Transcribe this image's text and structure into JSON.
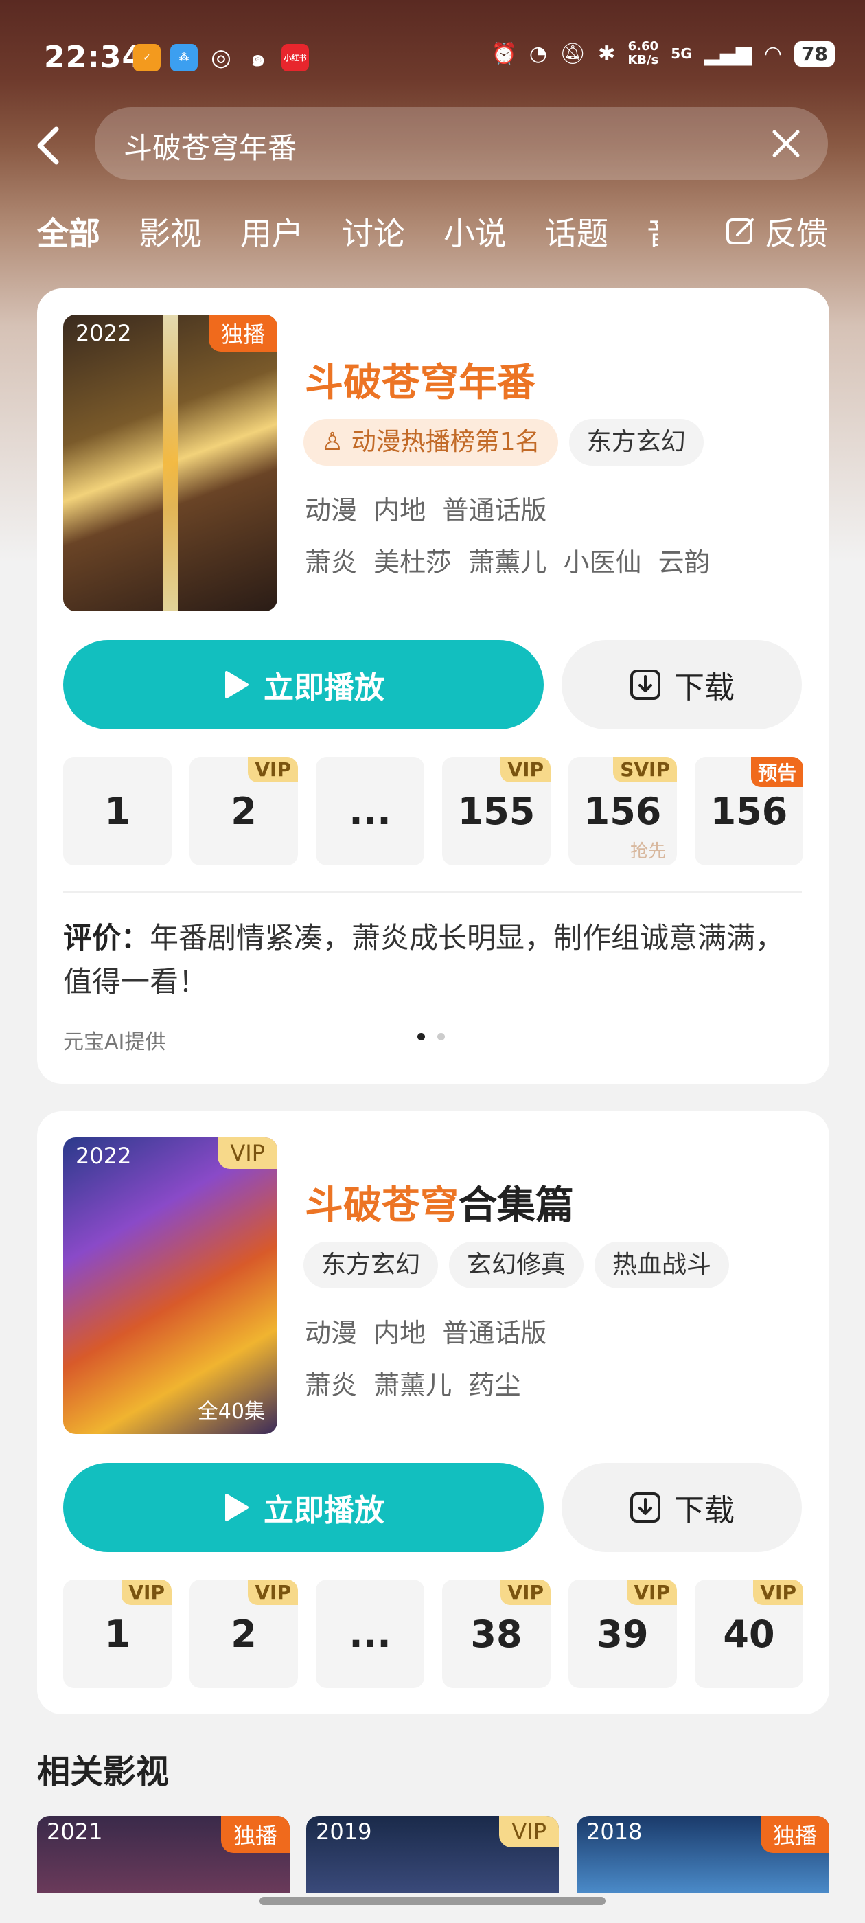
{
  "status_bar": {
    "time": "22:34",
    "app_icons": [
      "taobao-icon",
      "alipay-icon",
      "wechat-icon",
      "weibo-icon",
      "xiaohongshu-icon"
    ],
    "xiaohongshu_text": "小红书",
    "net_speed": "6.60",
    "net_unit": "KB/s",
    "signal": "5G",
    "battery": "78"
  },
  "search": {
    "query": "斗破苍穹年番"
  },
  "tabs": [
    "全部",
    "影视",
    "用户",
    "讨论",
    "小说",
    "话题",
    "音"
  ],
  "feedback_label": "反馈",
  "result1": {
    "year": "2022",
    "badge": "独播",
    "title": "斗破苍穹年番",
    "rank_chip": "动漫热播榜第1名",
    "genre_chip": "东方玄幻",
    "meta": "动漫  内地  普通话版",
    "cast": "萧炎  美杜莎  萧薰儿  小医仙  云韵",
    "play_label": "立即播放",
    "download_label": "下载",
    "episodes": [
      {
        "num": "1",
        "badge": "",
        "sub": ""
      },
      {
        "num": "2",
        "badge": "VIP",
        "sub": ""
      },
      {
        "num": "...",
        "badge": "",
        "sub": ""
      },
      {
        "num": "155",
        "badge": "VIP",
        "sub": ""
      },
      {
        "num": "156",
        "badge": "SVIP",
        "sub": "抢先"
      },
      {
        "num": "156",
        "badge": "预告",
        "sub": ""
      }
    ],
    "review_label": "评价：",
    "review_text": "年番剧情紧凑，萧炎成长明显，制作组诚意满满，值得一看！",
    "credit": "元宝AI提供",
    "page_dots": 2,
    "page_active": 1
  },
  "result2": {
    "year": "2022",
    "badge": "VIP",
    "episode_count": "全40集",
    "title_highlight": "斗破苍穹",
    "title_rest": "合集篇",
    "chips": [
      "东方玄幻",
      "玄幻修真",
      "热血战斗"
    ],
    "meta": "动漫  内地  普通话版",
    "cast": "萧炎  萧薰儿  药尘",
    "play_label": "立即播放",
    "download_label": "下载",
    "episodes": [
      {
        "num": "1",
        "badge": "VIP"
      },
      {
        "num": "2",
        "badge": "VIP"
      },
      {
        "num": "...",
        "badge": ""
      },
      {
        "num": "38",
        "badge": "VIP"
      },
      {
        "num": "39",
        "badge": "VIP"
      },
      {
        "num": "40",
        "badge": "VIP"
      }
    ]
  },
  "related": {
    "title": "相关影视",
    "items": [
      {
        "year": "2021",
        "badge": "独播"
      },
      {
        "year": "2019",
        "badge": "VIP"
      },
      {
        "year": "2018",
        "badge": "独播"
      }
    ]
  },
  "colors": {
    "accent_orange": "#ec7424",
    "teal": "#12bfbf",
    "vip_gold": "#f7d98a",
    "badge_orange": "#f06a1c"
  }
}
